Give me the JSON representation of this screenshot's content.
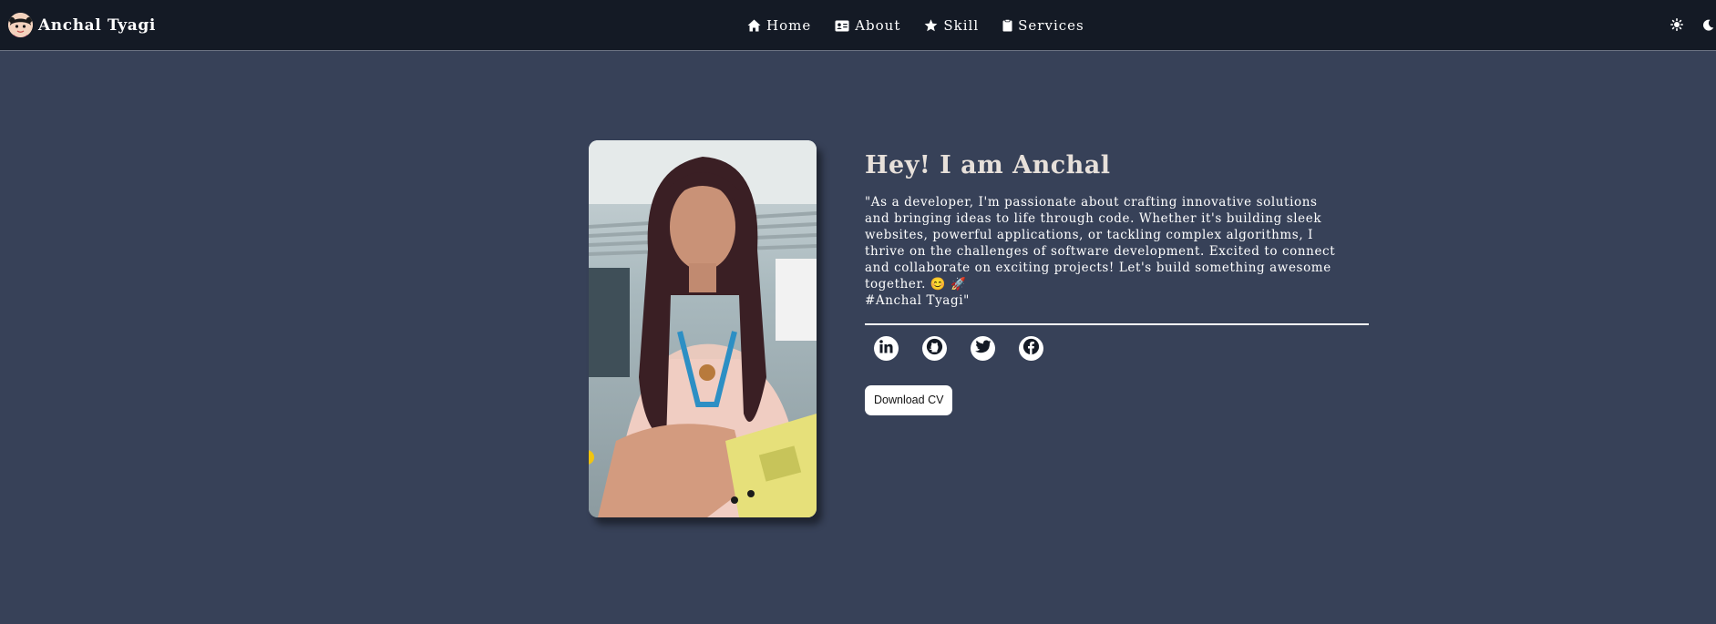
{
  "brand": {
    "name": "Anchal Tyagi",
    "avatar_icon": "cartoon-girl-avatar-icon"
  },
  "nav": {
    "items": [
      {
        "label": "Home",
        "icon": "home-icon"
      },
      {
        "label": "About",
        "icon": "id-card-icon"
      },
      {
        "label": "Skill",
        "icon": "star-icon"
      },
      {
        "label": "Services",
        "icon": "clipboard-icon"
      }
    ]
  },
  "theme_toggle": {
    "light_icon": "sun-icon",
    "dark_icon": "moon-icon"
  },
  "hero": {
    "title": "Hey! I am Anchal",
    "bio": "\"As a developer, I'm passionate about crafting innovative solutions\nand bringing ideas to life through code. Whether it's building sleek\nwebsites, powerful applications, or tackling complex algorithms, I\nthrive on the challenges of software development. Excited to connect\nand collaborate on exciting projects! Let's build something awesome\ntogether. 😊 🚀\n#Anchal Tyagi\"",
    "photo": "profile-photo",
    "socials": [
      {
        "name": "LinkedIn",
        "icon": "linkedin-icon"
      },
      {
        "name": "GitHub",
        "icon": "github-icon"
      },
      {
        "name": "Twitter",
        "icon": "twitter-icon"
      },
      {
        "name": "Facebook",
        "icon": "facebook-icon"
      }
    ],
    "cv_button_label": "Download CV"
  },
  "colors": {
    "navbar_bg": "#141a25",
    "page_bg": "#374158",
    "title_text": "#e7e0da",
    "text": "#ffffff"
  }
}
